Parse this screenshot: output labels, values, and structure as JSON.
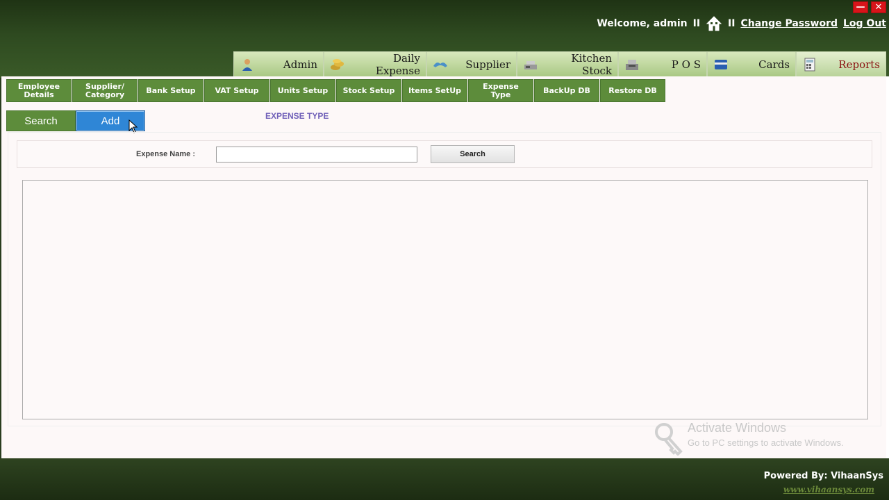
{
  "window": {
    "minimize_glyph": "—",
    "close_glyph": "✕"
  },
  "userbar": {
    "welcome": "Welcome, admin",
    "sep1": "II",
    "sep2": "II",
    "change_password": "Change Password",
    "logout": "Log Out"
  },
  "main_tabs": [
    {
      "label": "Admin",
      "icon": "user-icon"
    },
    {
      "label": "Daily Expense",
      "icon": "coins-icon"
    },
    {
      "label": "Supplier",
      "icon": "handshake-icon"
    },
    {
      "label": "Kitchen Stock",
      "icon": "scale-icon"
    },
    {
      "label": "P O S",
      "icon": "cash-register-icon"
    },
    {
      "label": "Cards",
      "icon": "card-icon"
    },
    {
      "label": "Reports",
      "icon": "calculator-icon"
    }
  ],
  "sub_tabs": [
    "Employee\nDetails",
    "Supplier/\nCategory",
    "Bank Setup",
    "VAT Setup",
    "Units Setup",
    "Stock Setup",
    "Items SetUp",
    "Expense\nType",
    "BackUp DB",
    "Restore DB"
  ],
  "actions": {
    "search": "Search",
    "add": "Add"
  },
  "page_title": "EXPENSE TYPE",
  "filter": {
    "label": "Expense Name :",
    "value": "",
    "button": "Search"
  },
  "watermark": {
    "title": "Activate Windows",
    "subtitle": "Go to PC settings to activate Windows."
  },
  "footer": {
    "powered": "Powered By: VihaanSys",
    "site": "www.vihaansys.com"
  },
  "colors": {
    "brand_green": "#5d8c3b",
    "accent_blue": "#2f86d6",
    "dark_green": "#2a3d1f"
  }
}
